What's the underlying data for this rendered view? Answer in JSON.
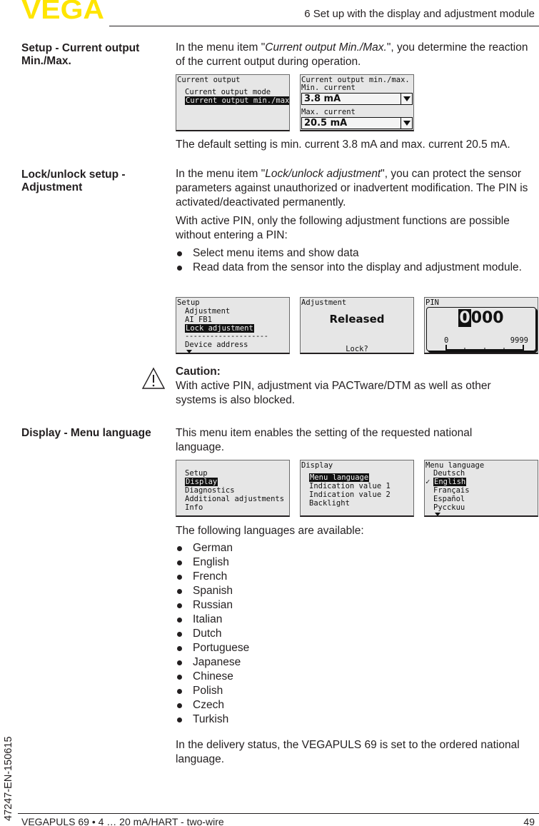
{
  "header": {
    "logo": "VEGA",
    "brand_color": "#ffe500",
    "chapter_title": "6 Set up with the display and adjustment module"
  },
  "sections": {
    "current_output": {
      "label": "Setup - Current output Min./Max.",
      "intro_pre": "In the menu item \"",
      "intro_italic": "Current output Min./Max.",
      "intro_post": "\", you determine the reaction of the current output during operation.",
      "screen1": {
        "title": "Current output",
        "items": [
          "Current output mode",
          "Current output min./max."
        ],
        "selected_index": 1
      },
      "screen2": {
        "title": "Current output min./max.",
        "min_label": "Min. current",
        "min_value": "3.8 mA",
        "max_label": "Max. current",
        "max_value": "20.5 mA"
      },
      "note": "The default setting is min. current 3.8 mA and max. current 20.5 mA."
    },
    "lock": {
      "label": "Lock/unlock setup - Adjustment",
      "intro_pre": "In the menu item \"",
      "intro_italic": "Lock/unlock adjustment",
      "intro_post": "\", you can protect the sensor parameters against unauthorized or inadvertent modification. The PIN is activated/deactivated permanently.",
      "para2": "With active PIN, only the following adjustment functions are possible without entering a PIN:",
      "bullets": [
        "Select menu items and show data",
        "Read data from the sensor into the display and adjustment module."
      ],
      "screen1": {
        "title": "Setup",
        "items": [
          "Adjustment",
          "AI FB1",
          "Lock adjustment",
          "--------------------",
          "Device address"
        ],
        "selected_index": 2
      },
      "screen2": {
        "title": "Adjustment",
        "status": "Released",
        "prompt": "Lock?"
      },
      "screen3": {
        "title": "PIN",
        "value": "0000",
        "cursor_digit": "0",
        "rest_digits": "000",
        "scale_min": "0",
        "scale_max": "9999"
      },
      "caution_title": "Caution:",
      "caution_text": "With active PIN, adjustment via PACTware/DTM as well as other systems is also blocked."
    },
    "language": {
      "label": "Display - Menu language",
      "intro": "This menu item enables the setting of the requested national language.",
      "screen1": {
        "items": [
          "Setup",
          "Display",
          "Diagnostics",
          "Additional adjustments",
          "Info"
        ],
        "selected_index": 1
      },
      "screen2": {
        "title": "Display",
        "items": [
          "Menu language",
          "Indication value 1",
          "Indication value 2",
          "Backlight"
        ],
        "selected_index": 0
      },
      "screen3": {
        "title": "Menu language",
        "items": [
          "Deutsch",
          "English",
          "Français",
          "Español",
          "Pycckuu"
        ],
        "selected_index": 1,
        "check_mark": "✓"
      },
      "available_intro": "The following languages are available:",
      "languages": [
        "German",
        "English",
        "French",
        "Spanish",
        "Russian",
        "Italian",
        "Dutch",
        "Portuguese",
        "Japanese",
        "Chinese",
        "Polish",
        "Czech",
        "Turkish"
      ],
      "closing": "In the delivery status, the VEGAPULS 69 is set to the ordered national language."
    }
  },
  "footer": {
    "product": "VEGAPULS 69 • 4 … 20 mA/HART - two-wire",
    "page_number": "49",
    "doc_code": "47247-EN-150615"
  }
}
